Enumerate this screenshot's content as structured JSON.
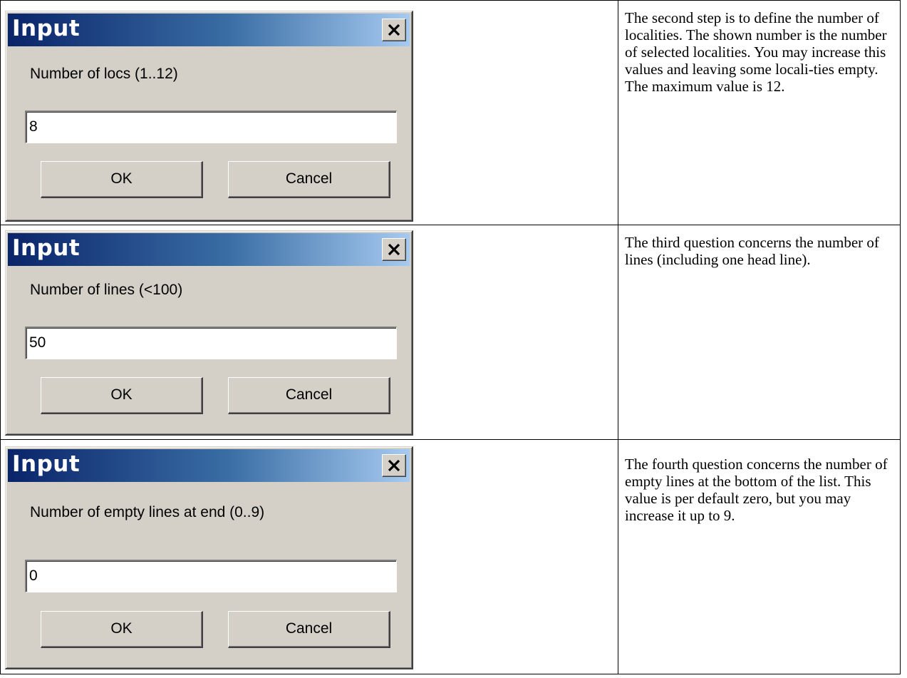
{
  "rows": [
    {
      "dialog": {
        "title": "Input",
        "prompt": "Number of locs (1..12)",
        "input_value": "8",
        "ok_label": "OK",
        "cancel_label": "Cancel",
        "close_icon": "close-icon"
      },
      "description": "The second step is to define the number of localities. The shown number is the number of selected localities. You may increase this values and leaving some locali-ties empty. The maximum value is 12."
    },
    {
      "dialog": {
        "title": "Input",
        "prompt": "Number of lines (<100)",
        "input_value": "50",
        "ok_label": "OK",
        "cancel_label": "Cancel",
        "close_icon": "close-icon"
      },
      "description": "The third question concerns the number of lines (including one head line)."
    },
    {
      "dialog": {
        "title": "Input",
        "prompt": "Number of empty lines at end (0..9)",
        "input_value": "0",
        "ok_label": "OK",
        "cancel_label": "Cancel",
        "close_icon": "close-icon"
      },
      "description": "The fourth question concerns the number of empty lines at the bottom of the list. This value is per default zero, but you may increase it up to 9."
    }
  ],
  "colors": {
    "titlebar_start": "#0a246a",
    "titlebar_end": "#a6caf0",
    "dialog_face": "#d4d0c8"
  }
}
